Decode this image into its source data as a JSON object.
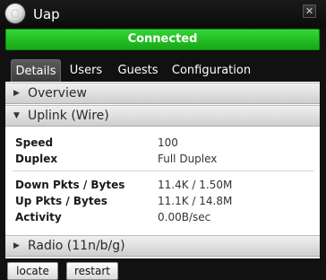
{
  "window": {
    "title": "Uap",
    "status": "Connected",
    "colors": {
      "status_bg": "#22c022",
      "background": "#111111"
    }
  },
  "tabs": [
    {
      "label": "Details",
      "active": true
    },
    {
      "label": "Users",
      "active": false
    },
    {
      "label": "Guests",
      "active": false
    },
    {
      "label": "Configuration",
      "active": false
    }
  ],
  "sections": {
    "overview": {
      "label": "Overview",
      "expanded": false
    },
    "uplink": {
      "label": "Uplink (Wire)",
      "expanded": true
    },
    "radio": {
      "label": "Radio (11n/b/g)",
      "expanded": false
    }
  },
  "uplink": {
    "speed": {
      "label": "Speed",
      "value": "100"
    },
    "duplex": {
      "label": "Duplex",
      "value": "Full Duplex"
    },
    "down": {
      "label": "Down Pkts / Bytes",
      "value": "11.4K / 1.50M"
    },
    "up": {
      "label": "Up Pkts / Bytes",
      "value": "11.1K / 14.8M"
    },
    "activity": {
      "label": "Activity",
      "value": "0.00B/sec"
    }
  },
  "buttons": {
    "locate": "locate",
    "restart": "restart"
  },
  "icons": {
    "app": "access-point-icon",
    "close": "close-icon",
    "collapsed": "triangle-right-icon",
    "expanded": "triangle-down-icon"
  }
}
